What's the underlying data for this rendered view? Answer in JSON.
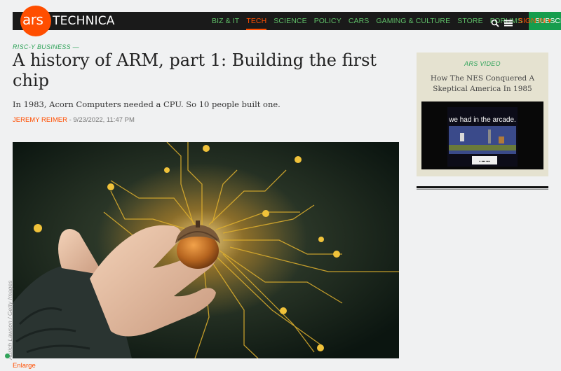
{
  "site": {
    "logo_ars": "ars",
    "logo_technica": "TECHNICA",
    "accent": "#ff4e00",
    "nav_green": "#5fbf68"
  },
  "nav": {
    "items": [
      {
        "label": "BIZ & IT"
      },
      {
        "label": "TECH",
        "active": true
      },
      {
        "label": "SCIENCE"
      },
      {
        "label": "POLICY"
      },
      {
        "label": "CARS"
      },
      {
        "label": "GAMING & CULTURE"
      },
      {
        "label": "STORE"
      },
      {
        "label": "FORUMS"
      }
    ],
    "subscribe": "SUBSCRIBE",
    "sign_in": "SIGN IN ▾",
    "icons": [
      "search-icon",
      "menu-icon"
    ]
  },
  "article": {
    "kicker": "RISC-Y BUSINESS —",
    "headline": "A history of ARM, part 1: Building the first chip",
    "dek": "In 1983, Acorn Computers needed a CPU. So 10 people built one.",
    "author": "JEREMY REIMER",
    "date": " - 9/23/2022, 11:47 PM",
    "image_credit": "Aurich Lawson / Getty Images",
    "enlarge": "Enlarge"
  },
  "sidebar": {
    "video_kicker": "ARS VIDEO",
    "video_title": "How The NES Conquered A Skeptical America In 1985",
    "thumb_caption": "we had in the arcade.",
    "thumb_bottom_text": "▪ ▪▪▪ ▪▪▪"
  }
}
